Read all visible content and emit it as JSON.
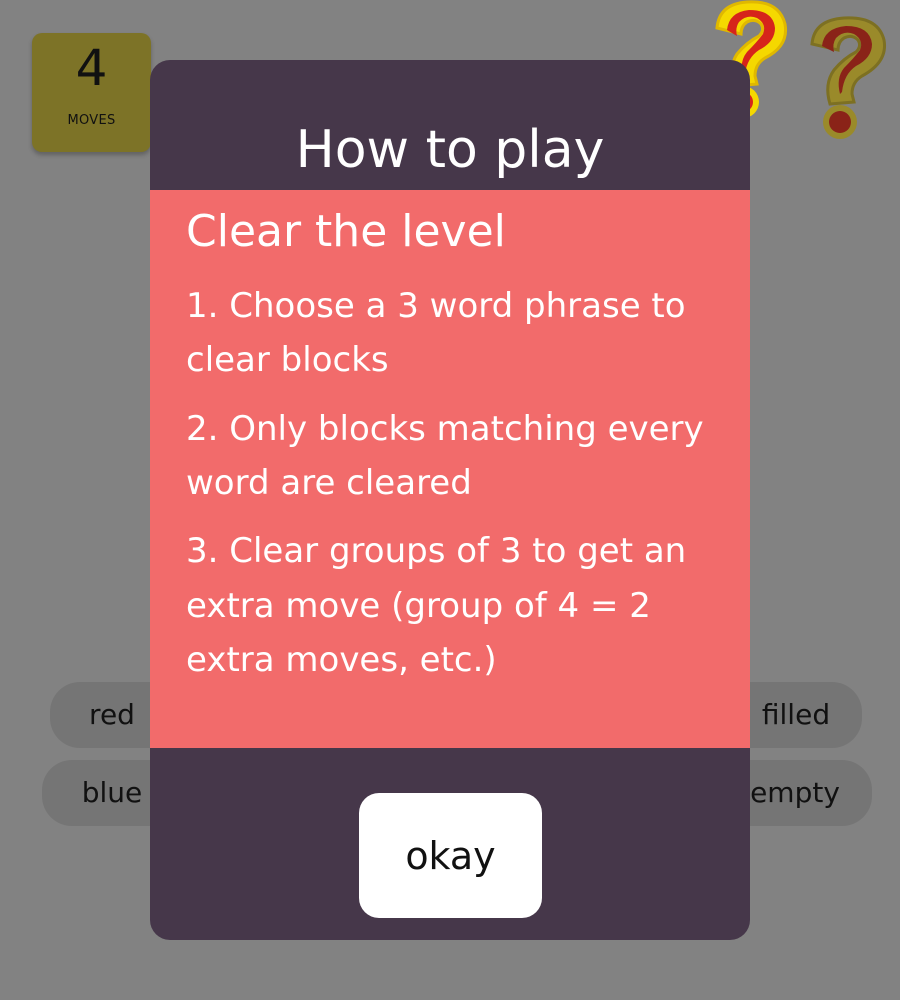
{
  "moves": {
    "count": "4",
    "label": "MOVES"
  },
  "help_icons": [
    "question-mark-icon",
    "question-mark-icon"
  ],
  "word_chips": {
    "left": [
      "red",
      "blue"
    ],
    "right": [
      "filled",
      "empty"
    ]
  },
  "modal": {
    "title": "How to play",
    "heading": "Clear the level",
    "steps": [
      "1. Choose a 3 word phrase to clear blocks",
      "2. Only blocks matching every word are cleared",
      "3. Clear groups of 3 to get an extra move (group of 4 = 2 extra moves, etc.)"
    ],
    "button_label": "okay"
  },
  "colors": {
    "overlay": "#828282",
    "moves_box": "#7d7327",
    "modal_bg": "#46374a",
    "panel_bg": "#f26b6b",
    "button_bg": "#ffffff",
    "help_icon_red": "#d6241b",
    "help_icon_yellow": "#f5d800"
  }
}
